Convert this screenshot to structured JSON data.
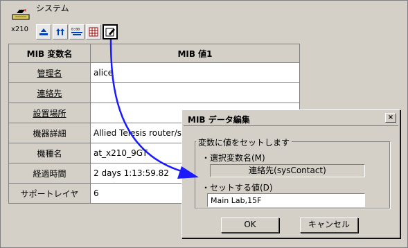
{
  "header": {
    "title": "システム",
    "device_label": "x210",
    "device_icon": "switch-device-icon"
  },
  "toolbar": {
    "buttons": [
      {
        "icon": "refresh-icon"
      },
      {
        "icon": "upload-icon"
      },
      {
        "icon": "interface-icon"
      },
      {
        "icon": "table-view-icon"
      },
      {
        "icon": "edit-icon",
        "active": true
      }
    ]
  },
  "table": {
    "headers": {
      "name": "MIB 変数名",
      "value": "MIB 値1"
    },
    "rows": [
      {
        "name": "管理名",
        "value": "alice",
        "editable": true
      },
      {
        "name": "連絡先",
        "value": "",
        "editable": true
      },
      {
        "name": "設置場所",
        "value": "",
        "editable": true
      },
      {
        "name": "機器詳細",
        "value": "Allied Telesis router/sw",
        "editable": false
      },
      {
        "name": "機種名",
        "value": "at_x210_9GT",
        "editable": false
      },
      {
        "name": "経過時間",
        "value": "2 days 1:13:59.82",
        "editable": false
      },
      {
        "name": "サポートレイヤ",
        "value": "6",
        "editable": false
      }
    ]
  },
  "dialog": {
    "title": "MIB データ編集",
    "close_label": "×",
    "group_label": "変数に値をセットします",
    "selected_label": "・選択変数名(M)",
    "selected_value": "連絡先(sysContact)",
    "set_label": "・セットする値(D)",
    "set_value": "Main Lab,15F",
    "ok_label": "OK",
    "cancel_label": "キャンセル"
  },
  "colors": {
    "arrow": "#1a1aff",
    "face": "#d4d0c8"
  }
}
